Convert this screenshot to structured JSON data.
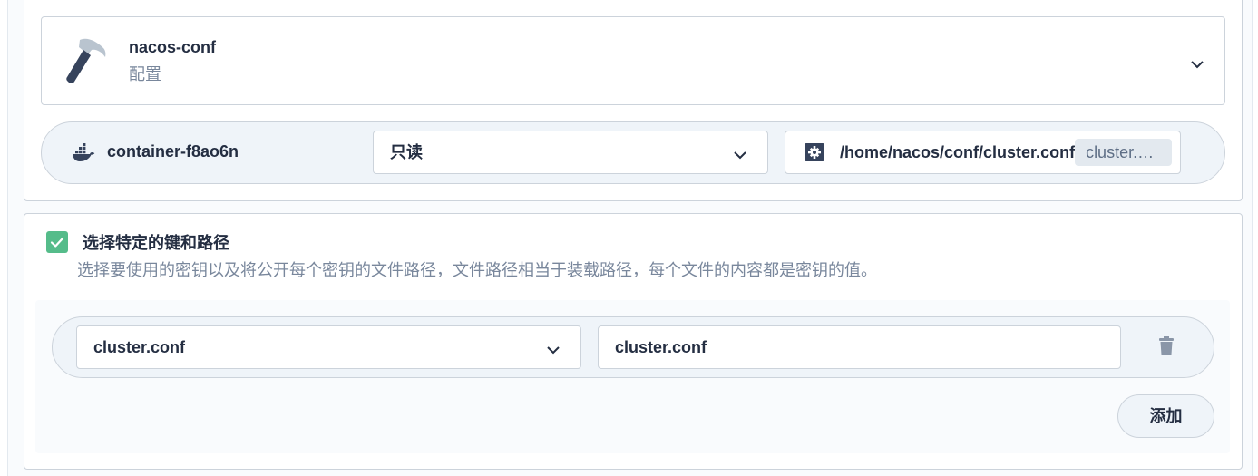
{
  "volume": {
    "icon": "hammer-icon",
    "name": "nacos-conf",
    "type_label": "配置",
    "expand_icon": "chevron-down-icon"
  },
  "mount": {
    "container_icon": "docker-icon",
    "container_name": "container-f8ao6n",
    "access_mode": "只读",
    "path_icon": "gear-box-icon",
    "mount_path": "/home/nacos/conf/cluster.conf",
    "sub_path": "cluster.…"
  },
  "specific_keys": {
    "checked": true,
    "title": "选择特定的键和路径",
    "description": "选择要使用的密钥以及将公开每个密钥的文件路径，文件路径相当于装载路径，每个文件的内容都是密钥的值。",
    "rows": [
      {
        "key": "cluster.conf",
        "path": "cluster.conf",
        "delete_icon": "trash-icon"
      }
    ],
    "add_label": "添加"
  },
  "colors": {
    "text_primary": "#242e42",
    "text_secondary": "#79879c",
    "border": "#ccd3db",
    "row_background": "#eff4f9",
    "checkbox_checked": "#55bc8a",
    "tag_background": "#e3e9ef",
    "panel_background": "#f9fbfd"
  }
}
